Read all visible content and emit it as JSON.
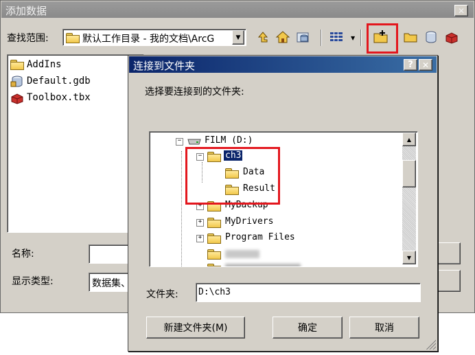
{
  "outer_dialog": {
    "title": "添加数据",
    "lookin_label": "查找范围:",
    "lookin_value": "默认工作目录 - 我的文档\\ArcG",
    "files": [
      {
        "name": "AddIns",
        "icon": "folder-icon"
      },
      {
        "name": "Default.gdb",
        "icon": "geodatabase-icon"
      },
      {
        "name": "Toolbox.tbx",
        "icon": "toolbox-icon"
      }
    ],
    "name_label": "名称:",
    "name_value": "",
    "type_label": "显示类型:",
    "type_value": "数据集、",
    "close_glyph": "✕"
  },
  "inner_dialog": {
    "title": "连接到文件夹",
    "help_glyph": "?",
    "close_glyph": "✕",
    "prompt": "选择要连接到的文件夹:",
    "tree": [
      {
        "label": "FILM (D:)",
        "icon": "drive-icon",
        "toggle": "−"
      },
      {
        "label": "ch3",
        "icon": "folder-icon",
        "toggle": "−",
        "selected": true
      },
      {
        "label": "Data",
        "icon": "folder-icon",
        "toggle": ""
      },
      {
        "label": "Result",
        "icon": "folder-icon",
        "toggle": ""
      },
      {
        "label": "MyBackup",
        "icon": "folder-icon",
        "toggle": "+"
      },
      {
        "label": "MyDrivers",
        "icon": "folder-icon",
        "toggle": "+"
      },
      {
        "label": "Program Files",
        "icon": "folder-icon",
        "toggle": "+"
      }
    ],
    "folder_label": "文件夹:",
    "folder_value": "D:\\ch3",
    "new_folder_button": "新建文件夹(M)",
    "ok_button": "确定",
    "cancel_button": "取消"
  },
  "colors": {
    "highlight_red": "#e3161d",
    "selection_blue": "#0a246a",
    "dialog_face": "#d4d0c8"
  }
}
